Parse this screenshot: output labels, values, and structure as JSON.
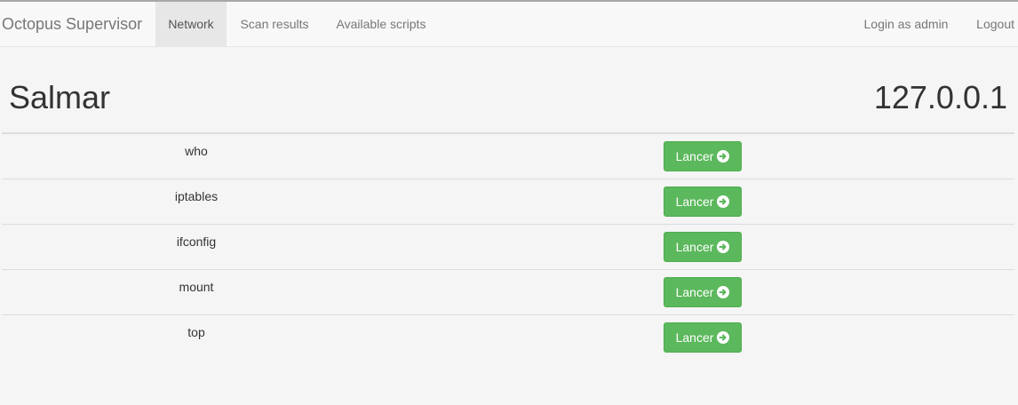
{
  "navbar": {
    "brand": "Octopus Supervisor",
    "items": [
      {
        "label": "Network",
        "active": true
      },
      {
        "label": "Scan results",
        "active": false
      },
      {
        "label": "Available scripts",
        "active": false
      }
    ],
    "right_items": [
      {
        "label": "Login as admin"
      },
      {
        "label": "Logout"
      }
    ]
  },
  "host": {
    "name": "Salmar",
    "ip": "127.0.0.1"
  },
  "scripts": [
    {
      "name": "who",
      "button_label": "Lancer"
    },
    {
      "name": "iptables",
      "button_label": "Lancer"
    },
    {
      "name": "ifconfig",
      "button_label": "Lancer"
    },
    {
      "name": "mount",
      "button_label": "Lancer"
    },
    {
      "name": "top",
      "button_label": "Lancer"
    }
  ],
  "colors": {
    "button_bg": "#5cb85c",
    "button_border": "#4cae4c",
    "navbar_bg": "#f8f8f8",
    "active_tab_bg": "#e7e7e7"
  },
  "icons": {
    "run_button_icon": "circle-arrow-right-icon"
  }
}
